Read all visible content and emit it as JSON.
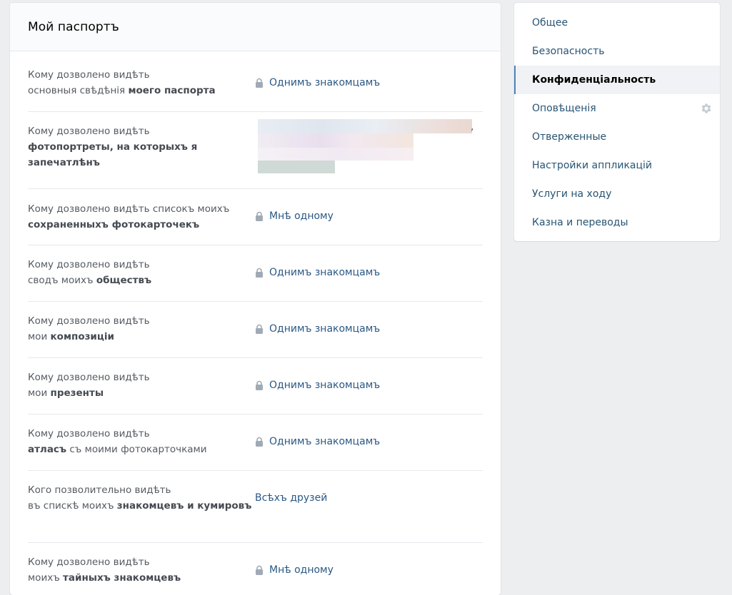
{
  "header": {
    "title": "Мой паспортъ"
  },
  "rows": [
    {
      "label_parts": [
        "Кому дозволено видѣть",
        "основныя свѣдѣнія ",
        "моего паспорта"
      ],
      "value": "Однимъ знакомцамъ"
    },
    {
      "label_parts": [
        "Кому дозволено видѣть",
        "фотопортреты, на которыхъ я запечатлѣнъ"
      ],
      "value": ","
    },
    {
      "label_parts": [
        "Кому дозволено видѣть списокъ моихъ",
        "сохраненныхъ фотокарточекъ"
      ],
      "value": "Мнѣ одному"
    },
    {
      "label_parts": [
        "Кому дозволено видѣть",
        "сводъ моихъ ",
        "обществъ"
      ],
      "value": "Однимъ знакомцамъ"
    },
    {
      "label_parts": [
        "Кому дозволено видѣть",
        "мои ",
        "композиціи"
      ],
      "value": "Однимъ знакомцамъ"
    },
    {
      "label_parts": [
        "Кому дозволено видѣть",
        "мои ",
        "презенты"
      ],
      "value": "Однимъ знакомцамъ"
    },
    {
      "label_parts": [
        "Кому дозволено видѣть",
        "атласъ",
        " съ моими фотокарточками"
      ],
      "value": "Однимъ знакомцамъ"
    },
    {
      "label_parts": [
        "Кого позволительно видѣть",
        "въ спискѣ моихъ ",
        "знакомцевъ и кумировъ"
      ],
      "value": "Всѣхъ друзей"
    },
    {
      "label_parts": [
        "Кому дозволено видѣть",
        "моихъ ",
        "тайныхъ знакомцевъ"
      ],
      "value": "Мнѣ одному"
    }
  ],
  "sidebar": {
    "items": [
      {
        "label": "Общее"
      },
      {
        "label": "Безопасность"
      },
      {
        "label": "Конфиденціальность"
      },
      {
        "label": "Оповѣщенія"
      },
      {
        "label": "Отверженные"
      },
      {
        "label": "Настройки аппликацій"
      },
      {
        "label": "Услуги на ходу"
      },
      {
        "label": "Казна и переводы"
      }
    ]
  },
  "colors": {
    "accent": "#5181b8",
    "link": "#2a5885",
    "background": "#edeef0"
  },
  "icons": {
    "lock": "lock-icon",
    "gear": "gear-icon"
  }
}
